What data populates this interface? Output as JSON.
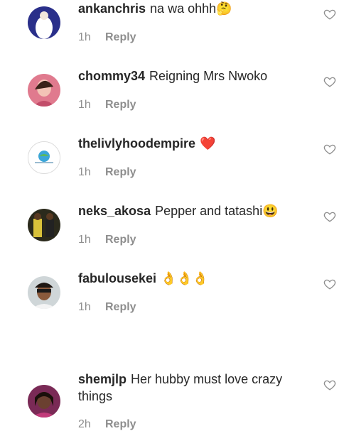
{
  "comments": [
    {
      "username": "ankanchris",
      "text": "na wa ohhh",
      "emoji": "🤔",
      "time": "1h",
      "reply": "Reply"
    },
    {
      "username": "chommy34",
      "text": "Reigning Mrs Nwoko",
      "emoji": "",
      "time": "1h",
      "reply": "Reply"
    },
    {
      "username": "thelivlyhoodempire",
      "text": "",
      "emoji": "❤️",
      "time": "1h",
      "reply": "Reply"
    },
    {
      "username": "neks_akosa",
      "text": "Pepper and tatashi",
      "emoji": "😃",
      "time": "1h",
      "reply": "Reply"
    },
    {
      "username": "fabulousekei",
      "text": "",
      "emoji": "👌👌👌",
      "time": "1h",
      "reply": "Reply"
    },
    {
      "username": "shemjlp",
      "text": "Her hubby must love crazy things",
      "emoji": "",
      "time": "2h",
      "reply": "Reply"
    }
  ],
  "colors": {
    "text": "#262626",
    "meta": "#8e8e8e",
    "heart_outline": "#8e8e8e",
    "background": "#ffffff"
  },
  "icons": {
    "like": "heart-outline-icon"
  }
}
